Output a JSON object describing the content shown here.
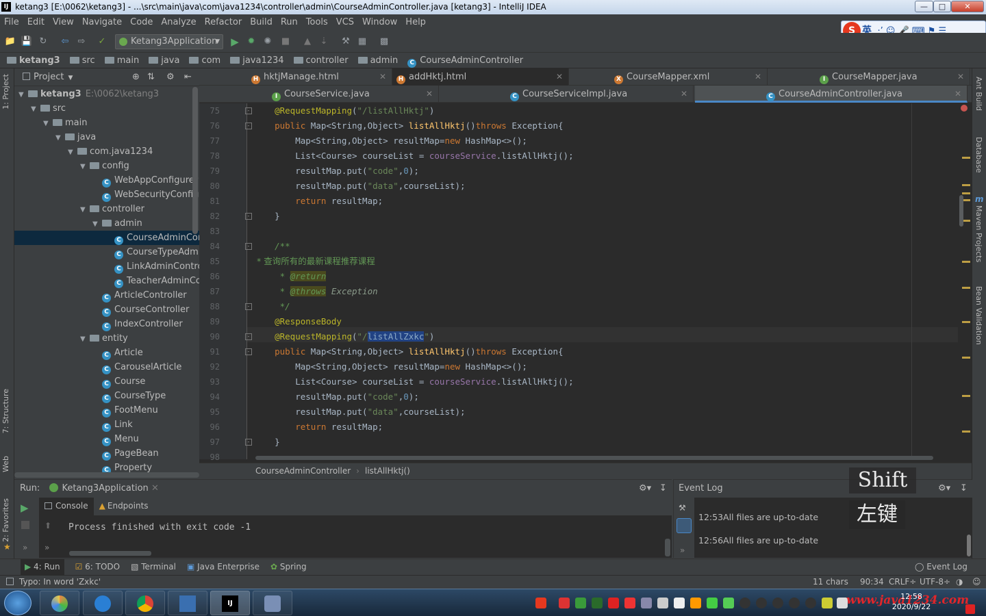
{
  "window": {
    "title": "ketang3 [E:\\0062\\ketang3] - ...\\src\\main\\java\\com\\java1234\\controller\\admin\\CourseAdminController.java [ketang3] - IntelliJ IDEA",
    "app_icon": "IJ"
  },
  "menu": [
    "File",
    "Edit",
    "View",
    "Navigate",
    "Code",
    "Analyze",
    "Refactor",
    "Build",
    "Run",
    "Tools",
    "VCS",
    "Window",
    "Help"
  ],
  "ime": {
    "logo": "S",
    "mode": "英",
    "symbols": "·’ ☺ 🎤 ⌨ ⚑ ☰"
  },
  "toolbar": {
    "run_config": "Ketang3Application"
  },
  "navbar": [
    "ketang3",
    "src",
    "main",
    "java",
    "com",
    "java1234",
    "controller",
    "admin",
    "CourseAdminController"
  ],
  "project": {
    "header": "Project",
    "tree": [
      {
        "label": "ketang3",
        "extra": "E:\\0062\\ketang3",
        "level": 0,
        "type": "module",
        "open": true
      },
      {
        "label": "src",
        "level": 1,
        "type": "folder",
        "open": true
      },
      {
        "label": "main",
        "level": 2,
        "type": "folder",
        "open": true
      },
      {
        "label": "java",
        "level": 3,
        "type": "folder",
        "open": true
      },
      {
        "label": "com.java1234",
        "level": 4,
        "type": "folder",
        "open": true
      },
      {
        "label": "config",
        "level": 5,
        "type": "folder",
        "open": true
      },
      {
        "label": "WebAppConfigurer",
        "level": 6,
        "type": "class"
      },
      {
        "label": "WebSecurityConfig",
        "level": 6,
        "type": "class"
      },
      {
        "label": "controller",
        "level": 5,
        "type": "folder",
        "open": true
      },
      {
        "label": "admin",
        "level": 6,
        "type": "folder",
        "open": true
      },
      {
        "label": "CourseAdminController",
        "level": 7,
        "type": "class",
        "selected": true
      },
      {
        "label": "CourseTypeAdminController",
        "level": 7,
        "type": "class"
      },
      {
        "label": "LinkAdminController",
        "level": 7,
        "type": "class"
      },
      {
        "label": "TeacherAdminController",
        "level": 7,
        "type": "class"
      },
      {
        "label": "ArticleController",
        "level": 6,
        "type": "class"
      },
      {
        "label": "CourseController",
        "level": 6,
        "type": "class"
      },
      {
        "label": "IndexController",
        "level": 6,
        "type": "class"
      },
      {
        "label": "entity",
        "level": 5,
        "type": "folder",
        "open": true
      },
      {
        "label": "Article",
        "level": 6,
        "type": "class"
      },
      {
        "label": "CarouselArticle",
        "level": 6,
        "type": "class"
      },
      {
        "label": "Course",
        "level": 6,
        "type": "class"
      },
      {
        "label": "CourseType",
        "level": 6,
        "type": "class"
      },
      {
        "label": "FootMenu",
        "level": 6,
        "type": "class"
      },
      {
        "label": "Link",
        "level": 6,
        "type": "class"
      },
      {
        "label": "Menu",
        "level": 6,
        "type": "class"
      },
      {
        "label": "PageBean",
        "level": 6,
        "type": "class"
      },
      {
        "label": "Property",
        "level": 6,
        "type": "class"
      }
    ]
  },
  "editor_tabs_row1": [
    "hktjManage.html",
    "addHktj.html",
    "CourseMapper.xml",
    "CourseMapper.java"
  ],
  "editor_tabs_row2": [
    "CourseService.java",
    "CourseServiceImpl.java",
    "CourseAdminController.java"
  ],
  "code": {
    "line_numbers": [
      "75",
      "76",
      "77",
      "78",
      "79",
      "80",
      "81",
      "82",
      "83",
      "84",
      "85",
      "86",
      "87",
      "88",
      "89",
      "90",
      "91",
      "92",
      "93",
      "94",
      "95",
      "96",
      "97",
      "98"
    ],
    "comment_cn": " * 查询所有的最新课程推荐课程",
    "selected_word": "listAllZxkc"
  },
  "editor_breadcrumb": [
    "CourseAdminController",
    "listAllHktj()"
  ],
  "run": {
    "label": "Run:",
    "config": "Ketang3Application",
    "tabs": [
      "Console",
      "Endpoints"
    ],
    "output": "Process finished with exit code -1"
  },
  "event_log": {
    "title": "Event Log",
    "entries": [
      {
        "time": "12:53",
        "text": "All files are up-to-date"
      },
      {
        "time": "12:56",
        "text": "All files are up-to-date"
      }
    ]
  },
  "key_overlay": {
    "key1": "Shift",
    "key2": "左键"
  },
  "bottom_tabs": [
    "4: Run",
    "6: TODO",
    "Terminal",
    "Java Enterprise",
    "Spring",
    "Event Log"
  ],
  "status": {
    "message": "Typo: In word 'Zxkc'",
    "chars": "11 chars",
    "position": "90:34",
    "line_sep": "CRLF÷",
    "encoding": "UTF-8÷"
  },
  "right_tools": [
    "Ant Build",
    "Database",
    "Maven Projects",
    "Bean Validation"
  ],
  "left_tools": [
    "1: Project",
    "7: Structure",
    "Web",
    "2: Favorites"
  ],
  "taskbar": {
    "time": "12:58",
    "date": "2020/9/22",
    "watermark": "www.java1234.com"
  }
}
